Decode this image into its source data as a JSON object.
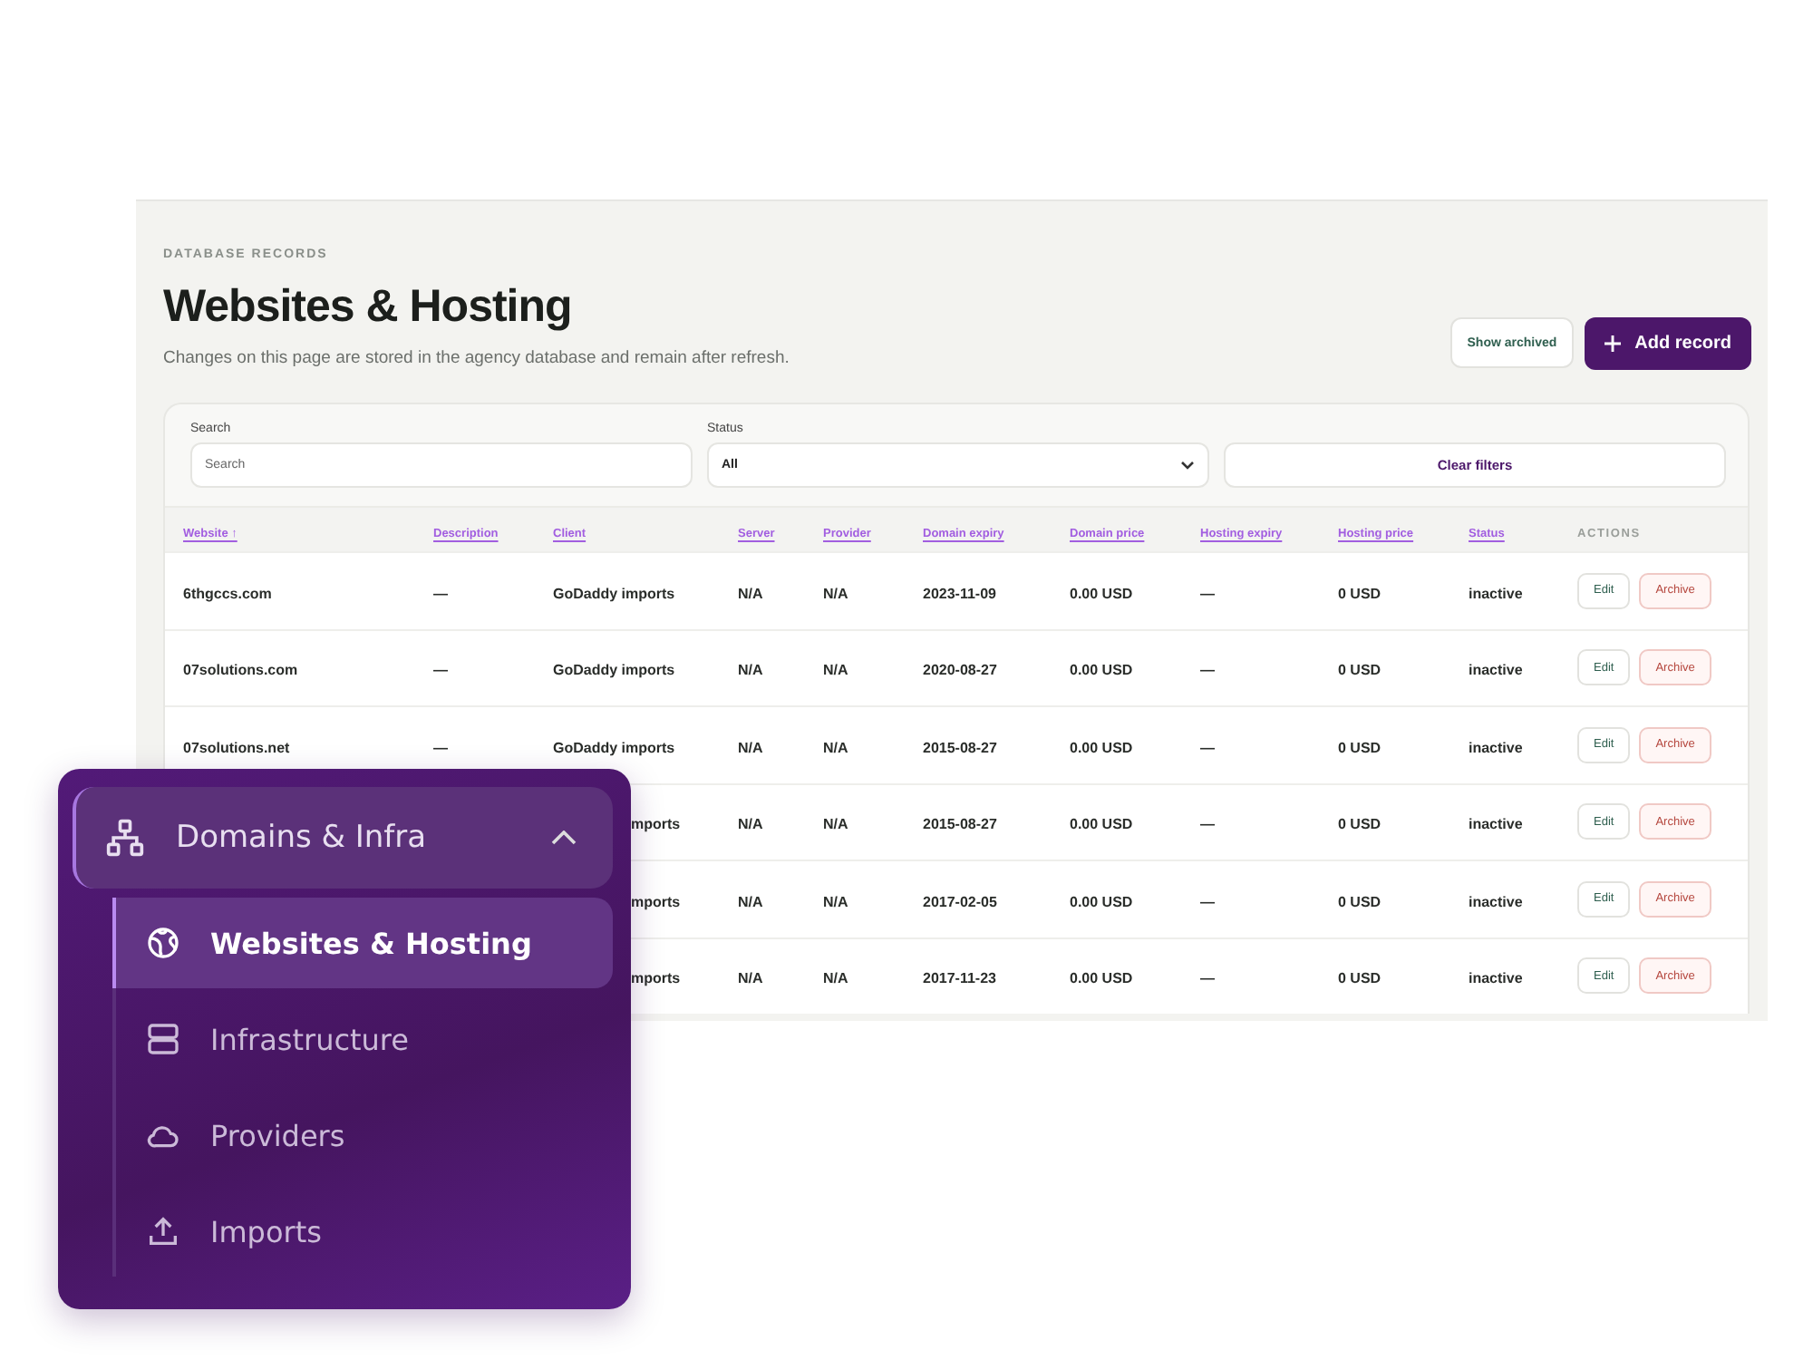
{
  "header": {
    "eyebrow": "DATABASE RECORDS",
    "title": "Websites & Hosting",
    "subtitle": "Changes on this page are stored in the agency database and remain after refresh.",
    "buttons": [
      {
        "label": "Show archived",
        "kind": "secondary"
      },
      {
        "label": "Add record",
        "kind": "primary"
      }
    ]
  },
  "filters": {
    "search": {
      "label": "Search",
      "placeholder": "Search"
    },
    "status": {
      "label": "Status",
      "value": "All"
    },
    "clear_button": "Clear filters"
  },
  "table": {
    "columns": [
      {
        "label": "Website ↑",
        "kind": "sortable"
      },
      {
        "label": "Description",
        "kind": "sortable"
      },
      {
        "label": "Client",
        "kind": "sortable"
      },
      {
        "label": "Server",
        "kind": "sortable"
      },
      {
        "label": "Provider",
        "kind": "sortable"
      },
      {
        "label": "Domain expiry",
        "kind": "sortable"
      },
      {
        "label": "Domain price",
        "kind": "sortable"
      },
      {
        "label": "Hosting expiry",
        "kind": "sortable"
      },
      {
        "label": "Hosting price",
        "kind": "sortable"
      },
      {
        "label": "Status",
        "kind": "sortable"
      },
      {
        "label": "ACTIONS",
        "kind": "plain"
      }
    ],
    "rows": [
      {
        "covered": false,
        "website": "6thgccs.com",
        "description": "—",
        "client": "GoDaddy imports",
        "server": "N/A",
        "provider": "N/A",
        "domain_expiry": "2023-11-09",
        "domain_price": "0.00 USD",
        "hosting_expiry": "—",
        "hosting_price": "0 USD",
        "status": "inactive",
        "actions": [
          {
            "label": "Edit",
            "kind": "edit"
          },
          {
            "label": "Archive",
            "kind": "danger"
          }
        ]
      },
      {
        "covered": false,
        "website": "07solutions.com",
        "description": "—",
        "client": "GoDaddy imports",
        "server": "N/A",
        "provider": "N/A",
        "domain_expiry": "2020-08-27",
        "domain_price": "0.00 USD",
        "hosting_expiry": "—",
        "hosting_price": "0 USD",
        "status": "inactive",
        "actions": [
          {
            "label": "Edit",
            "kind": "edit"
          },
          {
            "label": "Archive",
            "kind": "danger"
          }
        ]
      },
      {
        "covered": false,
        "website": "07solutions.net",
        "description": "—",
        "client": "GoDaddy imports",
        "server": "N/A",
        "provider": "N/A",
        "domain_expiry": "2015-08-27",
        "domain_price": "0.00 USD",
        "hosting_expiry": "—",
        "hosting_price": "0 USD",
        "status": "inactive",
        "actions": [
          {
            "label": "Edit",
            "kind": "edit"
          },
          {
            "label": "Archive",
            "kind": "danger"
          }
        ]
      },
      {
        "covered": true,
        "client": "mports",
        "server": "N/A",
        "provider": "N/A",
        "domain_expiry": "2015-08-27",
        "domain_price": "0.00 USD",
        "hosting_expiry": "—",
        "hosting_price": "0 USD",
        "status": "inactive",
        "actions": [
          {
            "label": "Edit",
            "kind": "edit"
          },
          {
            "label": "Archive",
            "kind": "danger"
          }
        ]
      },
      {
        "covered": true,
        "client": "mports",
        "server": "N/A",
        "provider": "N/A",
        "domain_expiry": "2017-02-05",
        "domain_price": "0.00 USD",
        "hosting_expiry": "—",
        "hosting_price": "0 USD",
        "status": "inactive",
        "actions": [
          {
            "label": "Edit",
            "kind": "edit"
          },
          {
            "label": "Archive",
            "kind": "danger"
          }
        ]
      },
      {
        "covered": true,
        "client": "mports",
        "server": "N/A",
        "provider": "N/A",
        "domain_expiry": "2017-11-23",
        "domain_price": "0.00 USD",
        "hosting_expiry": "—",
        "hosting_price": "0 USD",
        "status": "inactive",
        "actions": [
          {
            "label": "Edit",
            "kind": "edit"
          },
          {
            "label": "Archive",
            "kind": "danger"
          }
        ]
      }
    ]
  },
  "nav": {
    "group": {
      "label": "Domains & Infra",
      "expanded": true
    },
    "items": [
      {
        "label": "Websites & Hosting",
        "selected": true
      },
      {
        "label": "Infrastructure",
        "selected": false
      },
      {
        "label": "Providers",
        "selected": false
      },
      {
        "label": "Imports",
        "selected": false
      }
    ]
  }
}
